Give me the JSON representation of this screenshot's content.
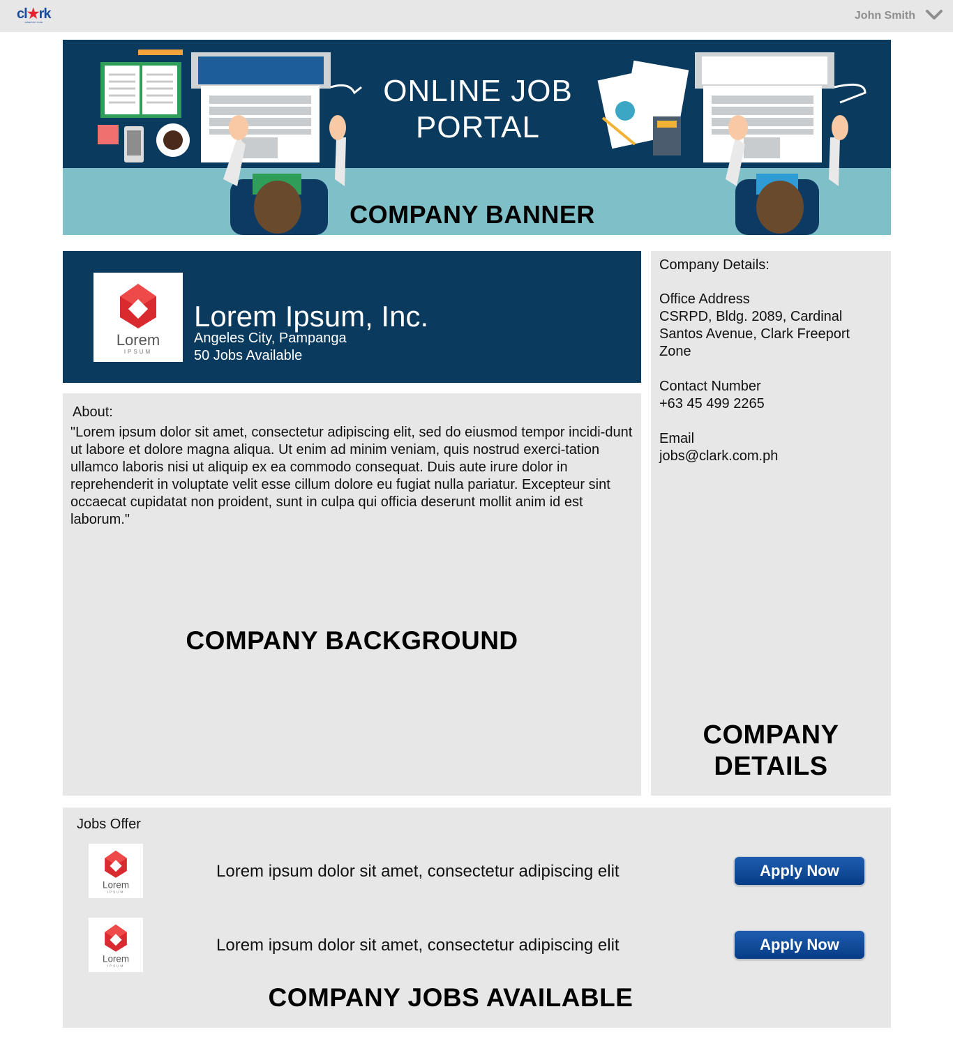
{
  "header": {
    "logo_text": "clark",
    "logo_tagline": "FREEPORT ZONE",
    "user_name": "John Smith"
  },
  "banner": {
    "title_line1": "ONLINE JOB",
    "title_line2": "PORTAL",
    "section_label": "COMPANY BANNER"
  },
  "profile": {
    "logo_name": "Lorem",
    "logo_sub": "IPSUM",
    "company_name": "Lorem Ipsum, Inc.",
    "location": "Angeles City, Pampanga",
    "jobs_available": "50 Jobs Available"
  },
  "about": {
    "label": "About:",
    "text": "\"Lorem ipsum dolor sit amet, consectetur adipiscing elit, sed do eiusmod tempor incidi-dunt ut labore et dolore magna aliqua. Ut enim ad minim veniam, quis nostrud exerci-tation ullamco laboris nisi ut aliquip ex ea commodo consequat. Duis aute irure dolor in reprehenderit in voluptate velit esse cillum dolore eu fugiat nulla pariatur. Excepteur sint occaecat cupidatat non proident, sunt in culpa qui officia deserunt mollit anim id est laborum.\"",
    "section_label": "COMPANY BACKGROUND"
  },
  "details": {
    "heading": "Company Details:",
    "address_label": "Office Address",
    "address_value": "CSRPD, Bldg. 2089, Cardinal Santos Avenue, Clark Freeport Zone",
    "contact_label": "Contact Number",
    "contact_value": "+63 45 499 2265",
    "email_label": "Email",
    "email_value": "jobs@clark.com.ph",
    "section_label_line1": "COMPANY",
    "section_label_line2": "DETAILS"
  },
  "jobs": {
    "title": "Jobs Offer",
    "items": [
      {
        "logo_name": "Lorem",
        "logo_sub": "IPSUM",
        "text": "Lorem ipsum dolor sit amet, consectetur adipiscing elit",
        "button": "Apply Now"
      },
      {
        "logo_name": "Lorem",
        "logo_sub": "IPSUM",
        "text": "Lorem ipsum dolor sit amet, consectetur adipiscing elit",
        "button": "Apply Now"
      }
    ],
    "section_label": "COMPANY JOBS AVAILABLE"
  },
  "colors": {
    "navy": "#0a3a5e",
    "teal": "#7fbfc8",
    "panel_gray": "#e8e7e8",
    "button_blue": "#1f5db0",
    "logo_red": "#d92a2f"
  }
}
